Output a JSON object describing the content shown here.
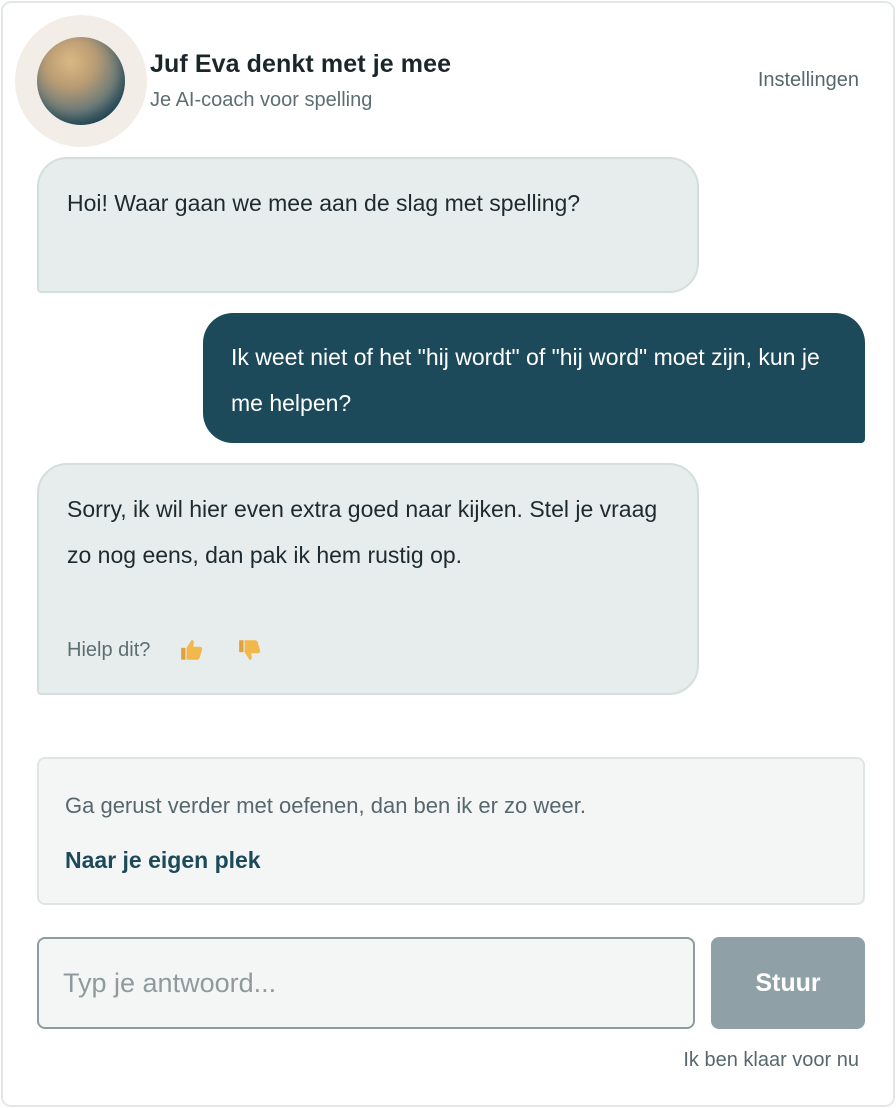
{
  "header": {
    "title": "Juf Eva denkt met je mee",
    "subtitle": "Je AI-coach voor spelling",
    "settings_label": "Instellingen"
  },
  "messages": [
    {
      "role": "bot",
      "text": "Hoi! Waar gaan we mee aan de slag met spelling?"
    },
    {
      "role": "user",
      "text": "Ik weet niet of het \"hij wordt\" of \"hij word\" moet zijn, kun je me helpen?"
    },
    {
      "role": "bot",
      "text": "Sorry, ik wil hier even extra goed naar kijken. Stel je vraag zo nog eens, dan pak ik hem rustig op."
    }
  ],
  "feedback": {
    "question": "Hielp dit?",
    "thumbs_up_icon": "thumbs-up-icon",
    "thumbs_down_icon": "thumbs-down-icon",
    "icon_color": "#f2b84b"
  },
  "panel": {
    "text": "Ga gerust verder met oefenen, dan ben ik er zo weer.",
    "link_label": "Naar je eigen plek"
  },
  "composer": {
    "placeholder": "Typ je antwoord...",
    "value": "",
    "send_label": "Stuur"
  },
  "footer": {
    "done_label": "Ik ben klaar voor nu"
  },
  "colors": {
    "accent": "#1c4a5a",
    "bot_bubble": "#e7ecec",
    "send_button": "#8fa1a7"
  }
}
